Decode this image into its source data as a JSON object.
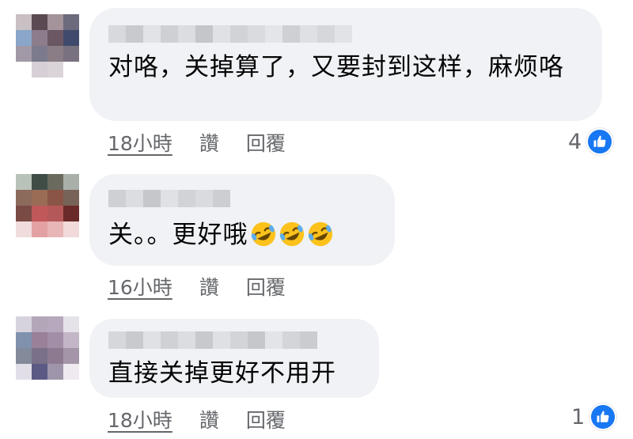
{
  "comments": [
    {
      "text": "对咯，关掉算了，又要封到这样，麻烦咯",
      "time": "18小時",
      "like_label": "讚",
      "reply_label": "回覆",
      "like_count": "4"
    },
    {
      "text": "关。。更好哦",
      "emojis": [
        "rolling-on-floor-laughing",
        "rolling-on-floor-laughing",
        "rolling-on-floor-laughing"
      ],
      "time": "16小時",
      "like_label": "讚",
      "reply_label": "回覆"
    },
    {
      "text": "直接关掉更好不用开",
      "time": "18小時",
      "like_label": "讚",
      "reply_label": "回覆",
      "like_count": "1"
    }
  ],
  "colors": {
    "bubble": "#f0f2f5",
    "meta_text": "#65676b",
    "like_blue": "#1877f2"
  }
}
